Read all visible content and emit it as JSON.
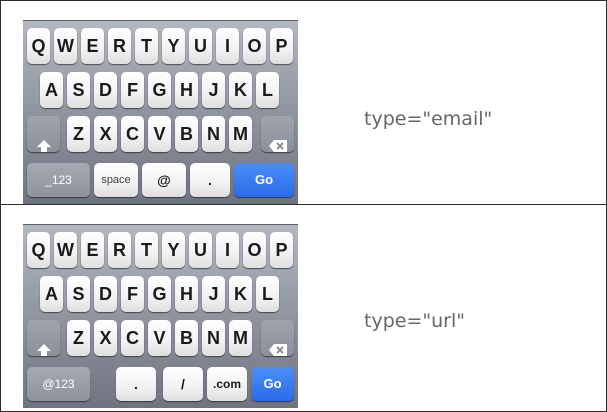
{
  "keyboards": [
    {
      "caption": "type=\"email\"",
      "row1": [
        "Q",
        "W",
        "E",
        "R",
        "T",
        "Y",
        "U",
        "I",
        "O",
        "P"
      ],
      "row2": [
        "A",
        "S",
        "D",
        "F",
        "G",
        "H",
        "J",
        "K",
        "L"
      ],
      "row3": [
        "Z",
        "X",
        "C",
        "V",
        "B",
        "N",
        "M"
      ],
      "bottom": {
        "mode_key": "_123",
        "space_key": "space",
        "at_key": "@",
        "dot_key": ".",
        "go_key": "Go"
      },
      "icons": {
        "shift": "shift-arrow-icon",
        "delete": "delete-backspace-icon"
      }
    },
    {
      "caption": "type=\"url\"",
      "row1": [
        "Q",
        "W",
        "E",
        "R",
        "T",
        "Y",
        "U",
        "I",
        "O",
        "P"
      ],
      "row2": [
        "A",
        "S",
        "D",
        "F",
        "G",
        "H",
        "J",
        "K",
        "L"
      ],
      "row3": [
        "Z",
        "X",
        "C",
        "V",
        "B",
        "N",
        "M"
      ],
      "bottom": {
        "mode_key": "@123",
        "dot_key": ".",
        "slash_key": "/",
        "dotcom_key": ".com",
        "go_key": "Go"
      },
      "icons": {
        "shift": "shift-arrow-icon",
        "delete": "delete-backspace-icon"
      }
    }
  ],
  "colors": {
    "go_key": "#2a6de8",
    "caption_text": "#666666",
    "keyboard_bg": "#8c919c"
  }
}
